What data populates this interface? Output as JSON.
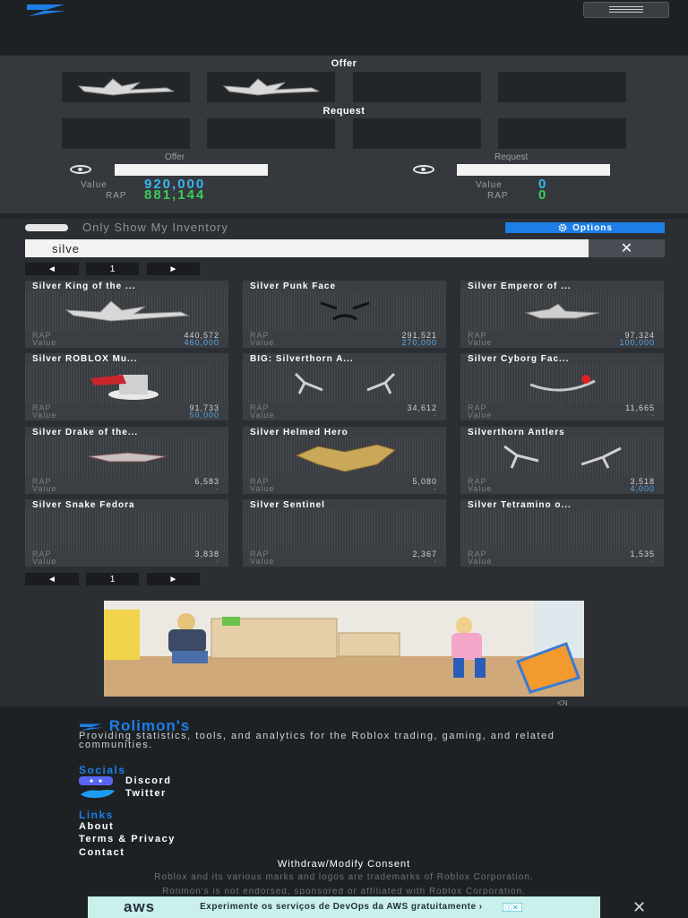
{
  "header": {
    "brand_icon": "rolimons-logo-icon",
    "menu_icon": "hamburger-icon"
  },
  "trade": {
    "offer_title": "Offer",
    "request_title": "Request",
    "offer_caption": "Offer",
    "request_caption": "Request",
    "offer_value_label": "Value",
    "offer_value": "920,000",
    "offer_rap_label": "RAP",
    "offer_rap": "881,144",
    "request_value_label": "Value",
    "request_value": "0",
    "request_rap_label": "RAP",
    "request_rap": "0",
    "colors": {
      "value": "#37b6f0",
      "rap": "#3ecb5a"
    }
  },
  "inventory": {
    "toggle_label": "Only Show My Inventory",
    "options_label": "Options",
    "search_value": "silve",
    "clear_label": "✕",
    "pager": {
      "prev": "◄",
      "page": "1",
      "next": "►"
    },
    "rap_label": "RAP",
    "value_label": "Value",
    "items": [
      {
        "name": "Silver King of the ...",
        "rap": "440,572",
        "value": "460,000"
      },
      {
        "name": "Silver Punk Face",
        "rap": "291,521",
        "value": "270,000"
      },
      {
        "name": "Silver Emperor of ...",
        "rap": "97,324",
        "value": "100,000"
      },
      {
        "name": "Silver ROBLOX Mu...",
        "rap": "91,733",
        "value": "50,000"
      },
      {
        "name": "BIG: Silverthorn A...",
        "rap": "34,612",
        "value": "-"
      },
      {
        "name": "Silver Cyborg Fac...",
        "rap": "11,665",
        "value": "-"
      },
      {
        "name": "Silver Drake of the...",
        "rap": "6,583",
        "value": "-"
      },
      {
        "name": "Silver Helmed Hero",
        "rap": "5,080",
        "value": "-"
      },
      {
        "name": "Silverthorn Antlers",
        "rap": "3,518",
        "value": "4,000"
      },
      {
        "name": "Silver Snake Fedora",
        "rap": "3,838",
        "value": "-"
      },
      {
        "name": "Silver Sentinel",
        "rap": "2,367",
        "value": "-"
      },
      {
        "name": "Silver Tetramino o...",
        "rap": "1,535",
        "value": "-"
      }
    ]
  },
  "footer": {
    "brand": "Rolimon's",
    "description": "Providing statistics, tools, and analytics for the Roblox trading, gaming, and related communities.",
    "socials_title": "Socials",
    "discord": "Discord",
    "twitter": "Twitter",
    "links_title": "Links",
    "about": "About",
    "terms": "Terms & Privacy",
    "contact": "Contact",
    "consent": "Withdraw/Modify Consent",
    "disclaimer1": "Roblox and its various marks and logos are trademarks of Roblox Corporation.",
    "disclaimer2": "Rolimon's is not endorsed, sponsored or affiliated with Roblox Corporation."
  },
  "ad": {
    "brand": "aws",
    "text": "Experimente os serviços de DevOps da AWS gratuitamente ›",
    "close": "✕"
  }
}
